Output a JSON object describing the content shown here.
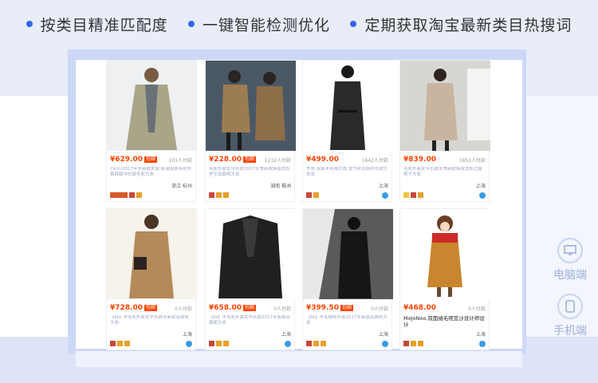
{
  "features": [
    {
      "label": "按类目精准匹配度"
    },
    {
      "label": "一键智能检测优化"
    },
    {
      "label": "定期获取淘宝最新类目热搜词"
    }
  ],
  "side": {
    "pc_label": "电脑端",
    "mobile_label": "手机端"
  },
  "products": [
    {
      "price": "¥629.00",
      "badge": "包邮",
      "sold": "101人付款",
      "title": "Ckchi2017年冬新款女装 新潮双面毛呢外套韩版中长款毛呢大衣",
      "location": "浙江 杭州",
      "icons": [
        "wide",
        "r",
        "o"
      ]
    },
    {
      "price": "¥228.00",
      "badge": "包邮",
      "sold": "1232人付款",
      "title": "毛呢外套女中长款2017冬季新款韩版宽松学生双面呢大衣",
      "location": "湖南 株洲",
      "icons": [
        "r",
        "o",
        "o"
      ]
    },
    {
      "price": "¥499.00",
      "badge": "",
      "sold": "1642人付款",
      "title": "东莞 双面羊毛绒大衣 女TXK双面中长款大衣女",
      "location": "上海",
      "icons": [
        "r",
        "o"
      ]
    },
    {
      "price": "¥839.00",
      "badge": "",
      "sold": "1853人付款",
      "title": "毛呢外套女中长款冬季新款韩版宽松过膝呢子大衣",
      "location": "上海",
      "icons": [
        "y",
        "r",
        "o"
      ]
    },
    {
      "price": "¥728.00",
      "badge": "包邮",
      "sold": "0人付款",
      "title": "【特】羊毛呢外套女中长款冬新款双面呢大衣",
      "location": "上海",
      "icons": [
        "r",
        "o",
        "o"
      ]
    },
    {
      "price": "¥658.00",
      "badge": "包邮",
      "sold": "0人付款",
      "title": "【特】羊毛呢外套女中长款2017冬新款双面呢大衣",
      "location": "上海",
      "icons": [
        "r",
        "o",
        "o"
      ]
    },
    {
      "price": "¥399.50",
      "badge": "包邮",
      "sold": "0人付款",
      "title": "【特】羊毛绒呢外套2017冬新款双面呢大衣",
      "location": "上海",
      "icons": [
        "r",
        "o",
        "o"
      ]
    },
    {
      "price": "¥468.00",
      "badge": "",
      "sold": "0人付款",
      "title": "MoJoNoo.双面绒毛呢豆沙设计师设计",
      "location": "上海",
      "icons": [
        "r",
        "o",
        "o"
      ]
    }
  ]
}
